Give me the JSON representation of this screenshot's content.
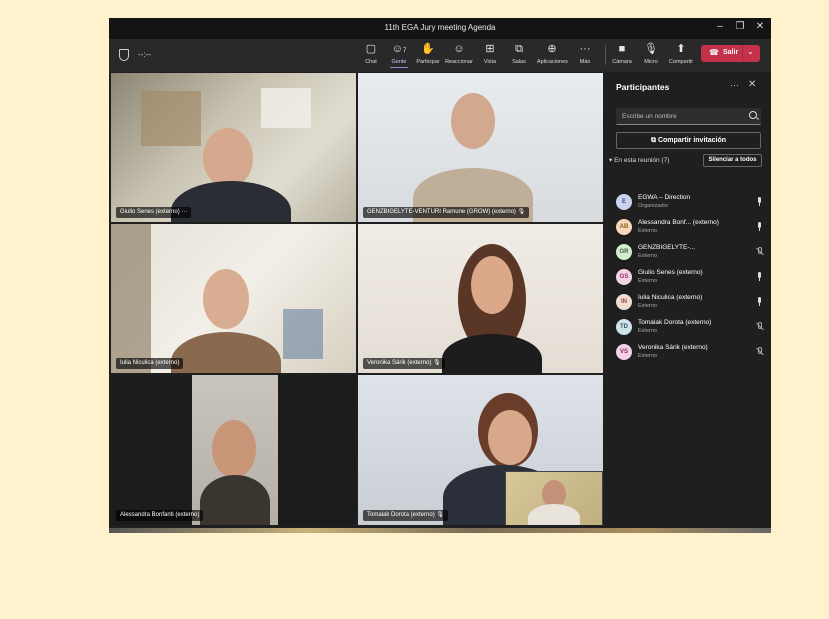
{
  "window": {
    "title": "11th EGA Jury meeting Agenda",
    "controls": [
      "–",
      "❐",
      "✕"
    ]
  },
  "toolbar": {
    "timer": "--:--",
    "buttons": [
      {
        "label": "Chat",
        "icon": "chat-icon"
      },
      {
        "label": "Gente",
        "icon": "people-icon",
        "badge": "7"
      },
      {
        "label": "Participar",
        "icon": "raise-hand-icon"
      },
      {
        "label": "Reaccionar",
        "icon": "emoji-icon"
      },
      {
        "label": "Vista",
        "icon": "view-icon"
      },
      {
        "label": "Salas",
        "icon": "rooms-icon"
      },
      {
        "label": "Aplicaciones",
        "icon": "apps-icon"
      },
      {
        "label": "Más",
        "icon": "more-icon"
      },
      {
        "label": "Cámara",
        "icon": "camera-icon"
      },
      {
        "label": "Micro",
        "icon": "mic-icon"
      },
      {
        "label": "Compartir",
        "icon": "share-icon"
      }
    ],
    "leave_label": "Salir"
  },
  "videos": [
    {
      "name": "Giulio Senes (externo)",
      "extra": "···"
    },
    {
      "name": "GENZBIGELYTE-VENTURI Ramune (GROW) (externo)"
    },
    {
      "name": "Iulia Niculica (externo)"
    },
    {
      "name": "Veronika Sárik (externo)"
    },
    {
      "name": "Alessandra Bonfanti (externo)"
    },
    {
      "name": "Tomalak Dorota (externo)"
    }
  ],
  "panel": {
    "title": "Participantes",
    "search_placeholder": "Escribe un nombre",
    "invite_label": "Compartir invitación",
    "section_label": "En esta reunión (7)",
    "mute_all_label": "Silenciar a todos",
    "participants": [
      {
        "initials": "E",
        "name": "EGWA – Direction",
        "role": "Organizador",
        "color": "#c9d3f0",
        "mic": "on"
      },
      {
        "initials": "AB",
        "name": "Alessandra Bonf...  (externo)",
        "role": "Externo",
        "color": "#f6d9b8",
        "mic": "on"
      },
      {
        "initials": "GR",
        "name": "GENZBIGELYTE-...",
        "role": "Externo",
        "color": "#d6ecd2",
        "mic": "off"
      },
      {
        "initials": "GS",
        "name": "Giulio Senes (externo)",
        "role": "Externo",
        "color": "#f3d2e6",
        "mic": "on"
      },
      {
        "initials": "IN",
        "name": "Iulia Niculica (externo)",
        "role": "Externo",
        "color": "#f3dcd0",
        "mic": "on"
      },
      {
        "initials": "TD",
        "name": "Tomalak Dorota (externo)",
        "role": "Externo",
        "color": "#cfe3ea",
        "mic": "off"
      },
      {
        "initials": "VS",
        "name": "Veronika Sárik (externo)",
        "role": "Externo",
        "color": "#f3d2e6",
        "mic": "off"
      }
    ]
  }
}
